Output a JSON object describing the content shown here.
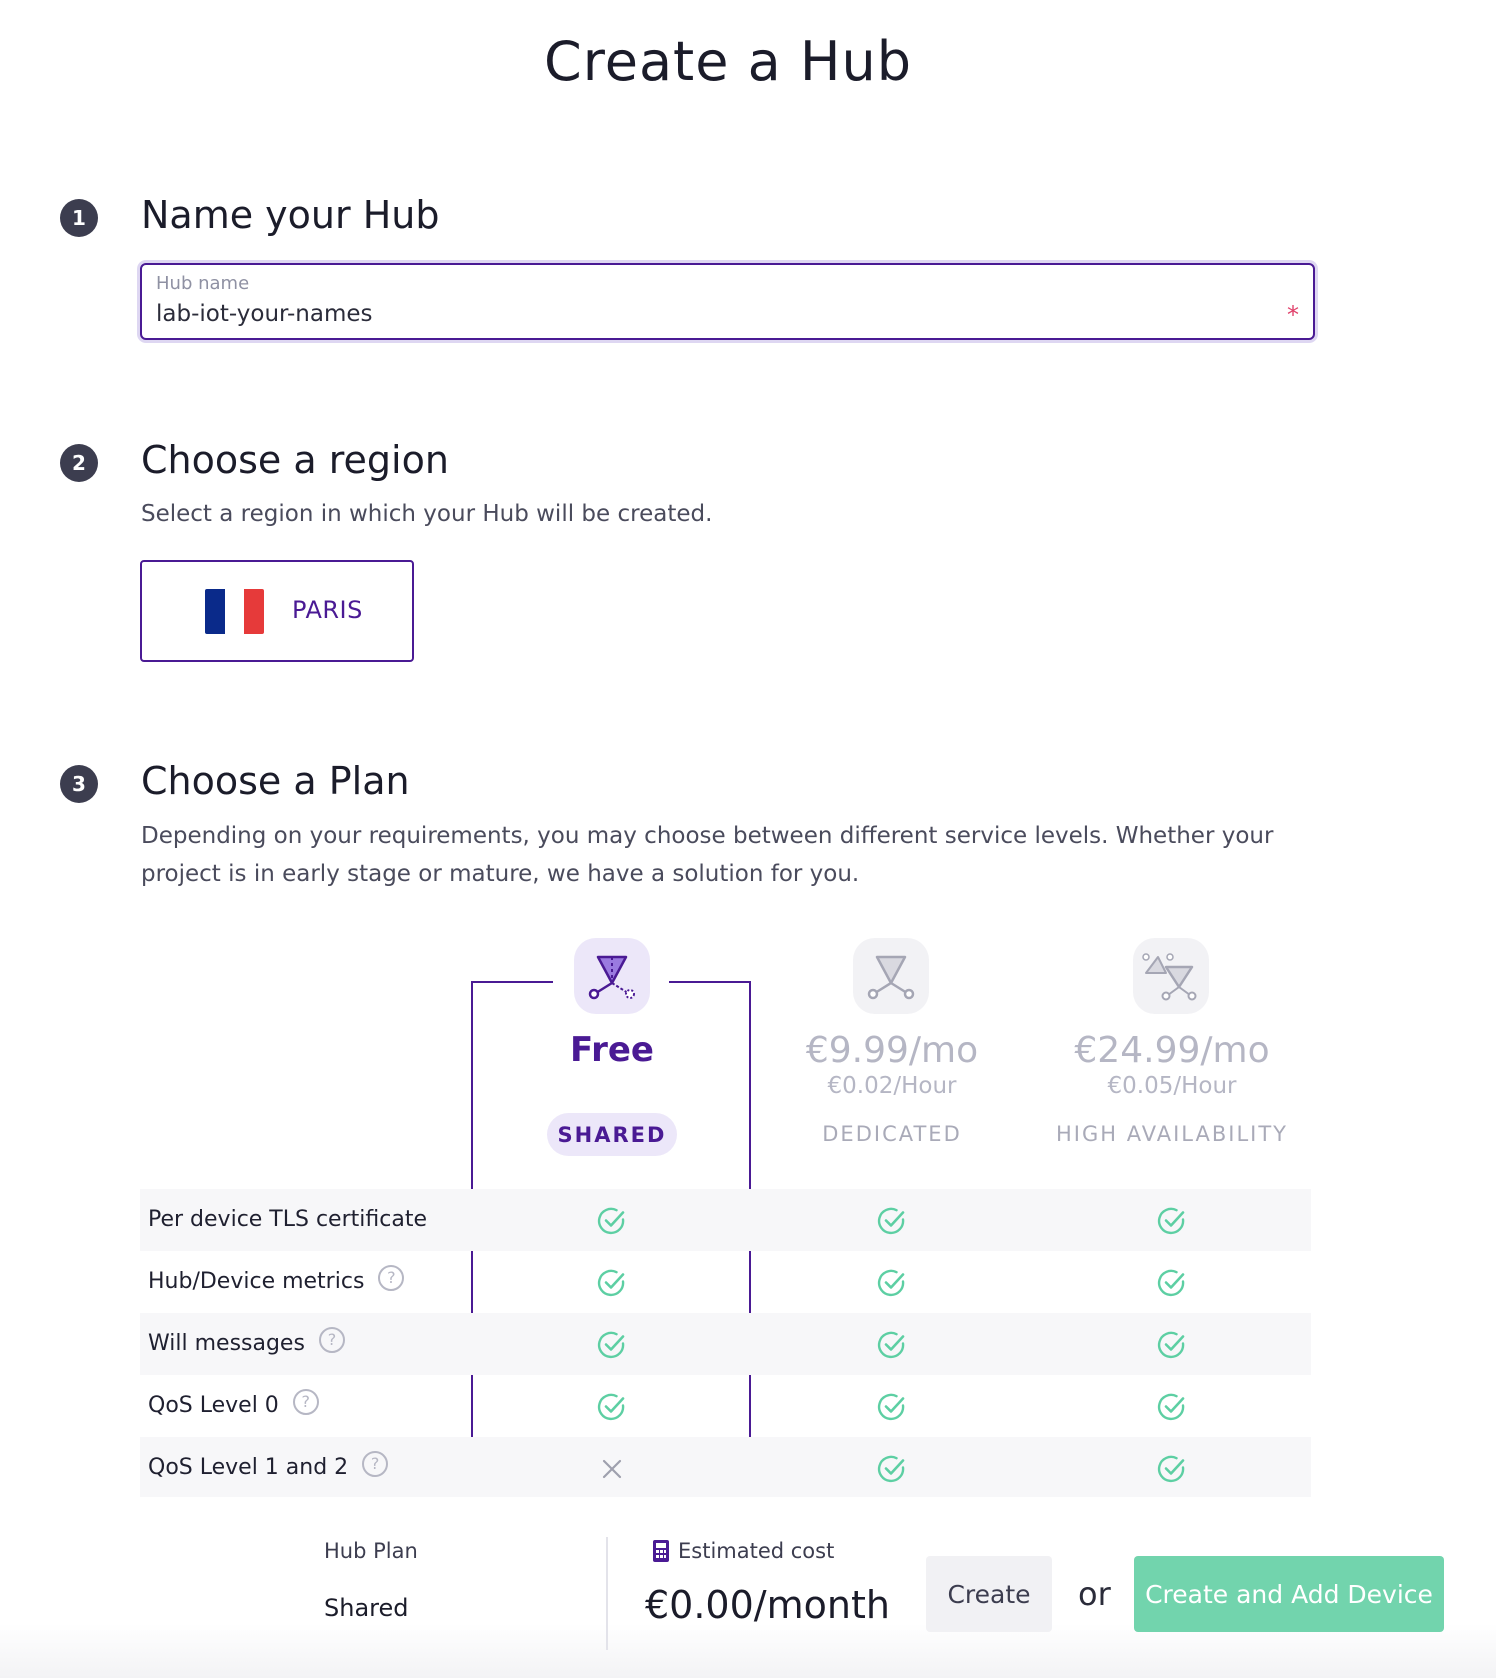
{
  "page": {
    "title": "Create a Hub"
  },
  "steps": [
    {
      "number": "1",
      "title": "Name your Hub"
    },
    {
      "number": "2",
      "title": "Choose a region",
      "description": "Select a region in which your Hub will be created."
    },
    {
      "number": "3",
      "title": "Choose a Plan",
      "description_line1": "Depending on your requirements, you may choose between different service levels. Whether your",
      "description_line2": "project is in early stage or mature, we have a solution for you."
    }
  ],
  "name_field": {
    "label": "Hub name",
    "value": "lab-iot-your-names",
    "required_mark": "*"
  },
  "region": {
    "name": "PARIS",
    "flag_colors": [
      "#0a2a8a",
      "#ffffff",
      "#e63a3a"
    ]
  },
  "plans": [
    {
      "price": "Free",
      "hour": "",
      "type": "SHARED",
      "icon": "shared-plan-icon",
      "selected": true
    },
    {
      "price": "€9.99/mo",
      "hour": "€0.02/Hour",
      "type": "DEDICATED",
      "icon": "dedicated-plan-icon",
      "selected": false
    },
    {
      "price": "€24.99/mo",
      "hour": "€0.05/Hour",
      "type": "HIGH AVAILABILITY",
      "icon": "high-availability-plan-icon",
      "selected": false
    }
  ],
  "features": [
    {
      "label": "Per device TLS certificate",
      "help": false,
      "values": [
        "check",
        "check",
        "check"
      ]
    },
    {
      "label": "Hub/Device metrics",
      "help": true,
      "values": [
        "check",
        "check",
        "check"
      ]
    },
    {
      "label": "Will messages",
      "help": true,
      "values": [
        "check",
        "check",
        "check"
      ]
    },
    {
      "label": "QoS Level 0",
      "help": true,
      "values": [
        "check",
        "check",
        "check"
      ]
    },
    {
      "label": "QoS Level 1 and 2",
      "help": true,
      "values": [
        "cross",
        "check",
        "check"
      ]
    }
  ],
  "help_glyph": "?",
  "summary": {
    "plan_label": "Hub Plan",
    "plan_value": "Shared",
    "cost_label": "Estimated cost",
    "cost_value": "€0.00/month",
    "create_label": "Create",
    "or_label": "or",
    "create_add_label": "Create and Add Device"
  },
  "colors": {
    "accent": "#4a1a94",
    "success": "#5dcfa3",
    "button_green": "#72d4ad"
  }
}
